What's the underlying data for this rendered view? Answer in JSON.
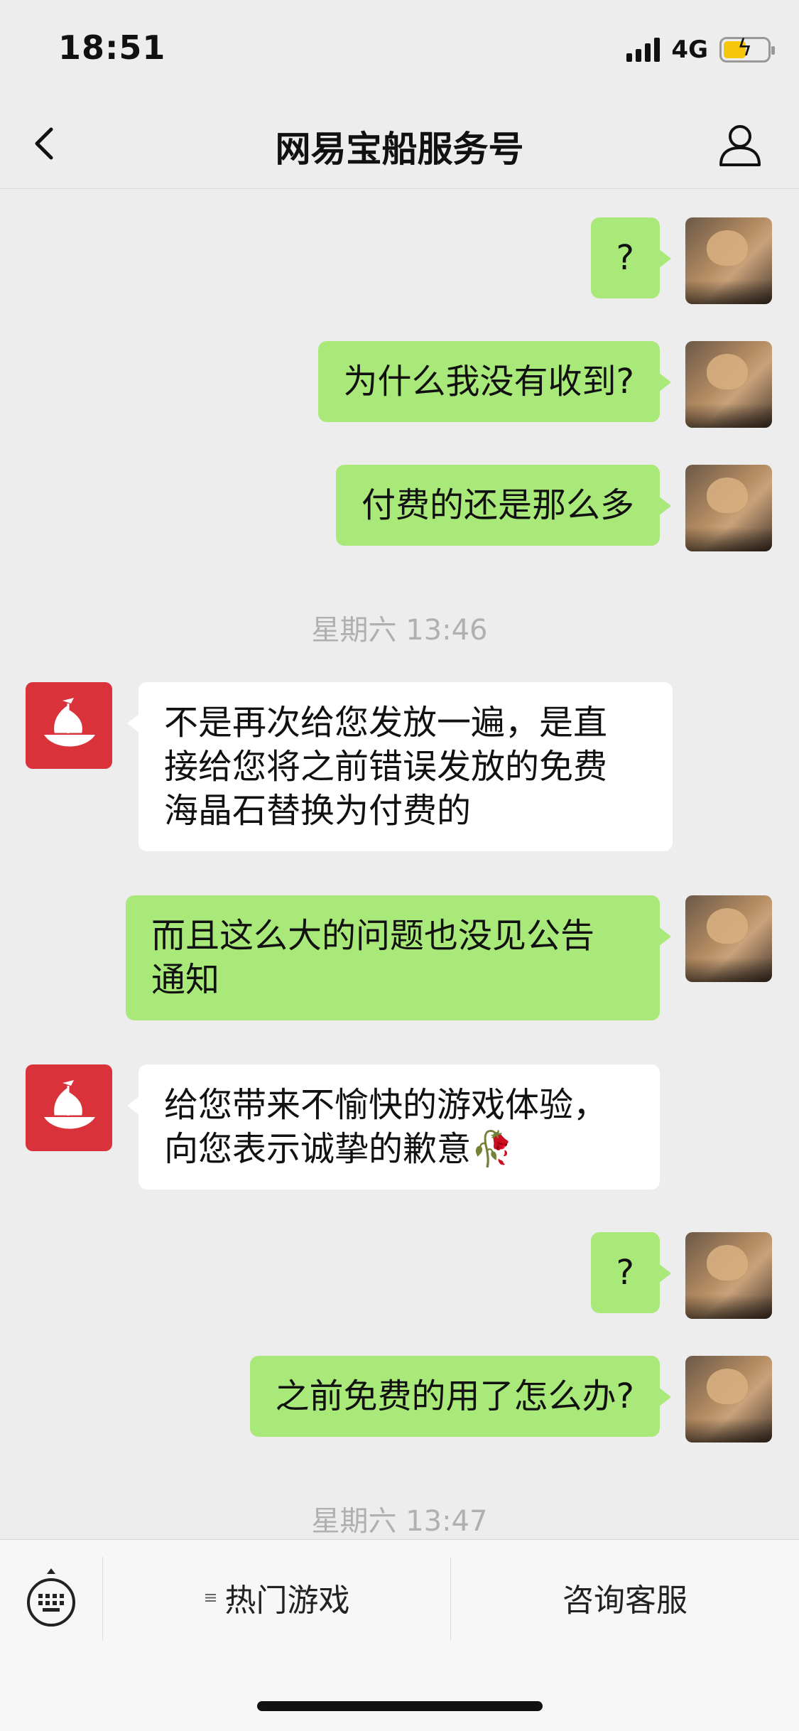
{
  "status_bar": {
    "time": "18:51",
    "network": "4G"
  },
  "nav": {
    "title": "网易宝船服务号"
  },
  "messages": [
    {
      "sender": "me",
      "text": "?"
    },
    {
      "sender": "me",
      "text": "为什么我没有收到?"
    },
    {
      "sender": "me",
      "text": "付费的还是那么多"
    },
    {
      "timestamp": "星期六 13:46"
    },
    {
      "sender": "them",
      "text": "不是再次给您发放一遍，是直\n接给您将之前错误发放的免费\n海晶石替换为付费的"
    },
    {
      "sender": "me",
      "text": "而且这么大的问题也没见公告\n通知"
    },
    {
      "sender": "them",
      "text": "给您带来不愉快的游戏体验，\n向您表示诚挚的歉意🥀"
    },
    {
      "sender": "me",
      "text": "?"
    },
    {
      "sender": "me",
      "text": "之前免费的用了怎么办?"
    },
    {
      "timestamp": "星期六 13:47"
    }
  ],
  "bottom_menu": {
    "items": [
      {
        "label": "热门游戏",
        "has_submenu": true
      },
      {
        "label": "咨询客服",
        "has_submenu": false
      }
    ]
  },
  "colors": {
    "my_bubble": "#a9e97a",
    "their_bubble": "#ffffff",
    "background": "#ededed",
    "brand": "#d9323a"
  },
  "icons": {
    "back": "chevron-left-icon",
    "profile": "person-icon",
    "keyboard": "keyboard-icon"
  }
}
